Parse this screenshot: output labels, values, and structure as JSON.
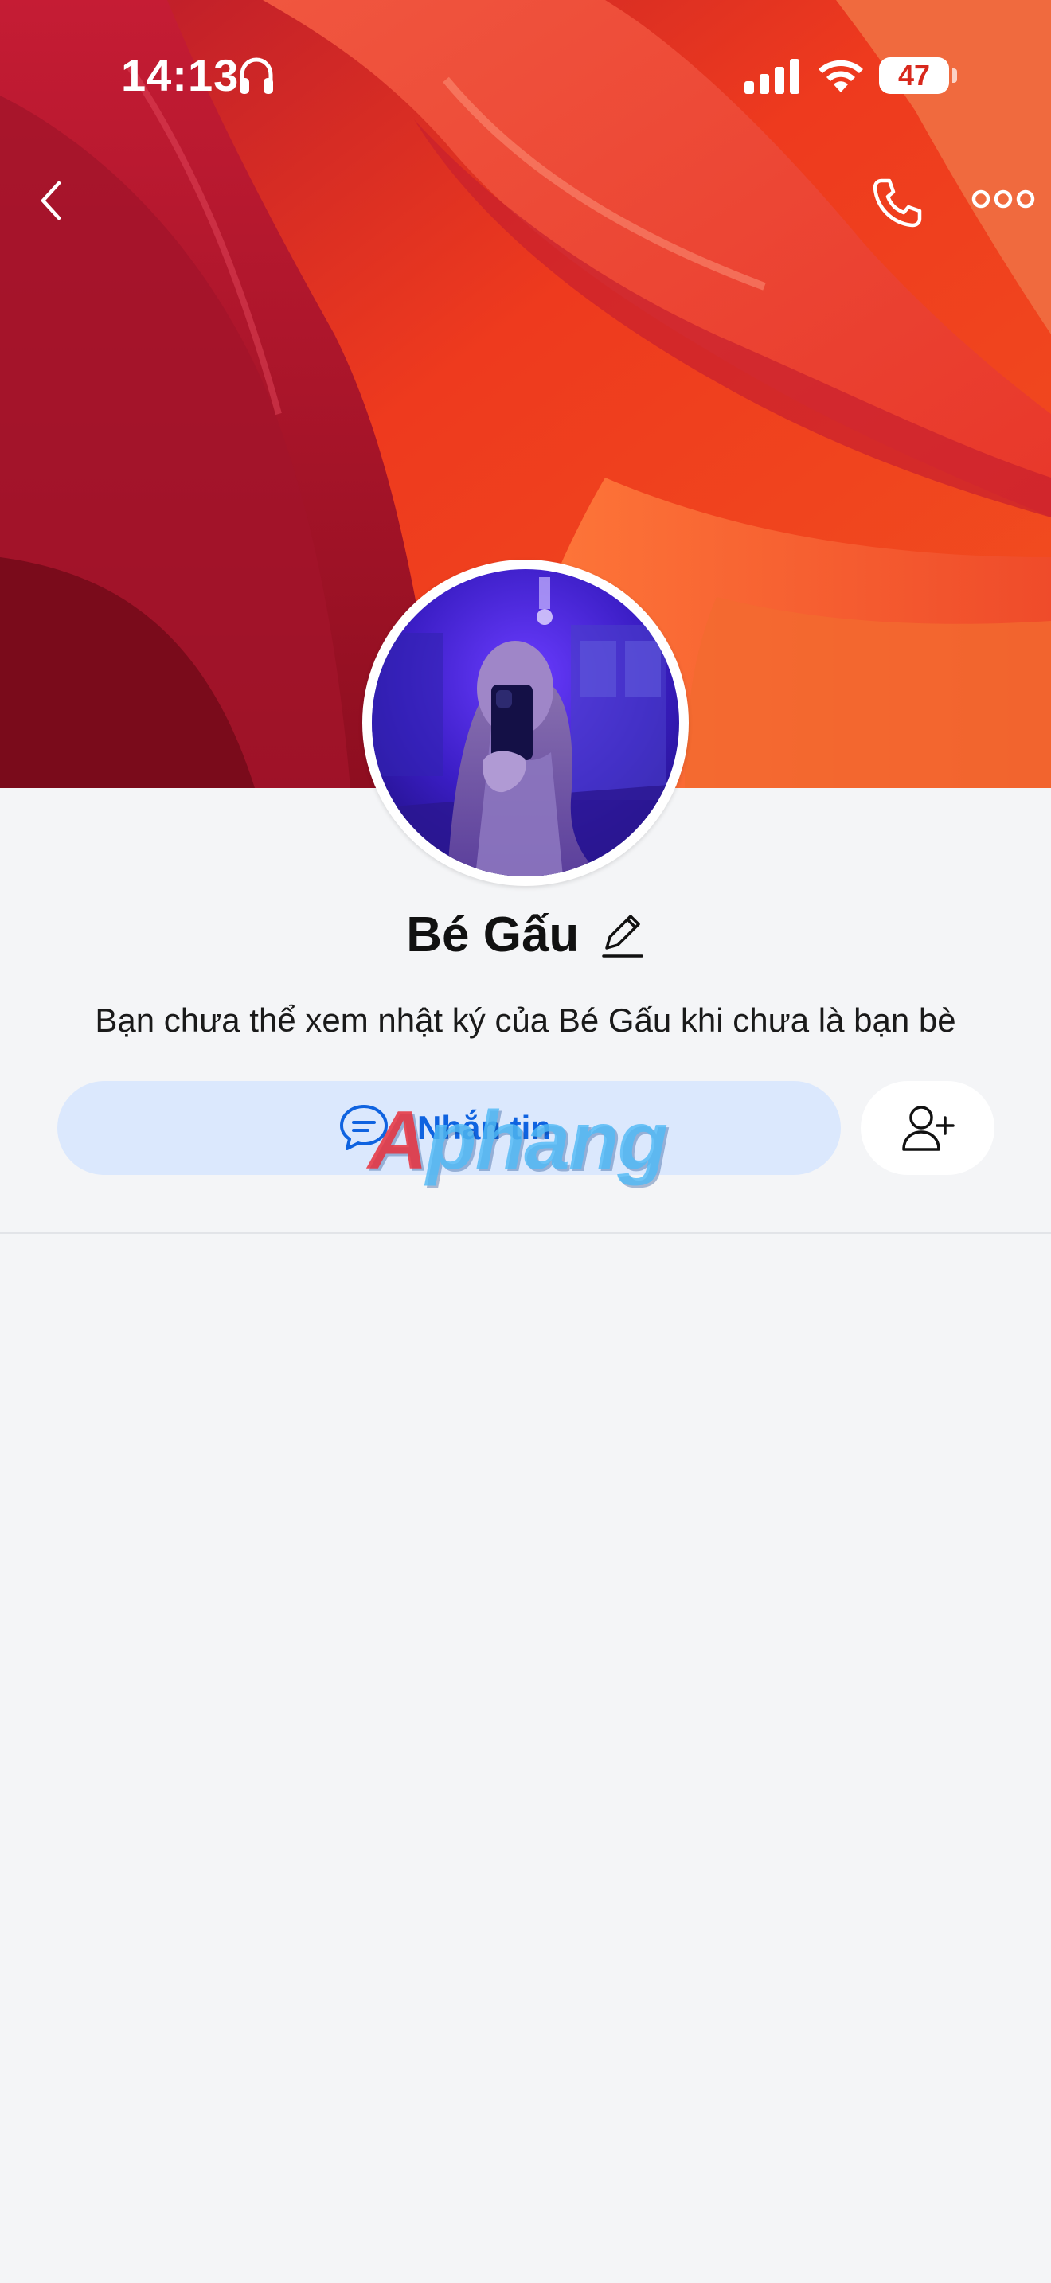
{
  "status_bar": {
    "time": "14:13",
    "battery": "47"
  },
  "icons": {
    "back": "chevron-left-icon",
    "call": "phone-icon",
    "more": "more-horizontal-icon",
    "edit": "pencil-icon",
    "message": "chat-bubble-icon",
    "add_friend": "add-user-icon"
  },
  "profile": {
    "name": "Bé Gấu",
    "privacy_note": "Bạn chưa thể xem nhật ký của Bé Gấu khi chưa là bạn bè"
  },
  "actions": {
    "message_label": "Nhắn tin"
  },
  "watermark": {
    "lead": "A",
    "rest": "phang"
  },
  "colors": {
    "accent": "#0f63e0",
    "message_button_bg": "#dbe8fd",
    "background": "#f4f5f7",
    "cover_red": "#d8281c"
  }
}
